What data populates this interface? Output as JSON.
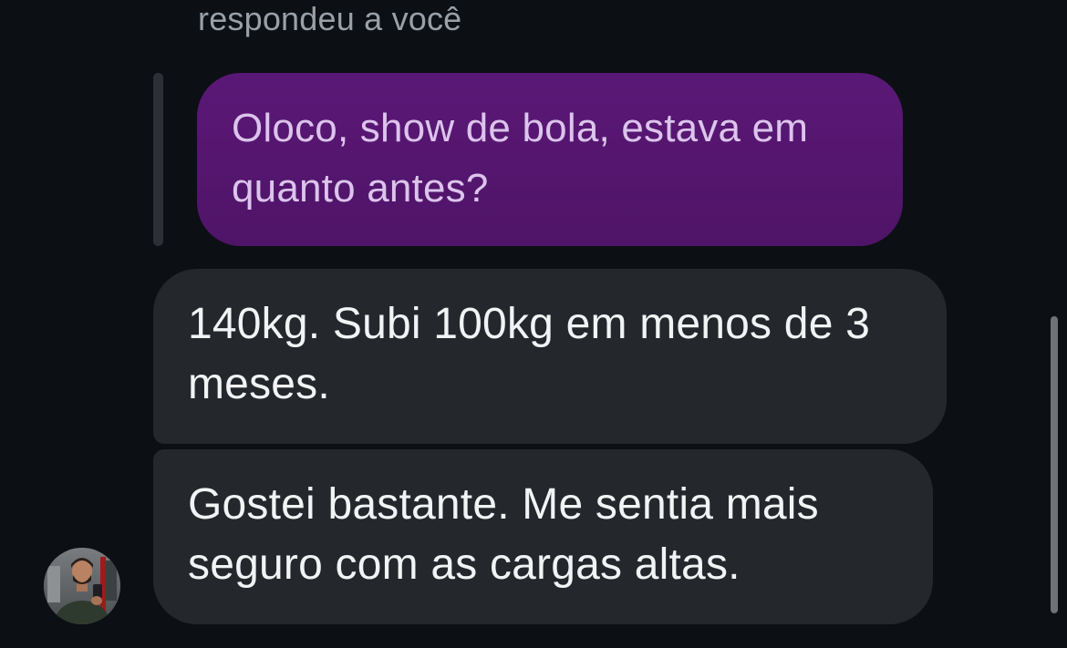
{
  "thread": {
    "reply_header": "respondeu a você",
    "quoted_message": {
      "text": "Oloco, show de bola, estava em quanto antes?"
    },
    "messages": [
      {
        "text": "140kg. Subi 100kg em menos de 3 meses."
      },
      {
        "text": "Gostei bastante. Me sentia mais seguro com as cargas altas."
      }
    ],
    "sender": {
      "avatar_icon": "user-avatar"
    }
  },
  "colors": {
    "background": "#0c0f14",
    "quoted_bubble": "#561872",
    "quoted_text": "#dcc4ec",
    "incoming_bubble": "#24272b",
    "incoming_text": "#f2f3f5",
    "muted_text": "#9aa0a8"
  }
}
